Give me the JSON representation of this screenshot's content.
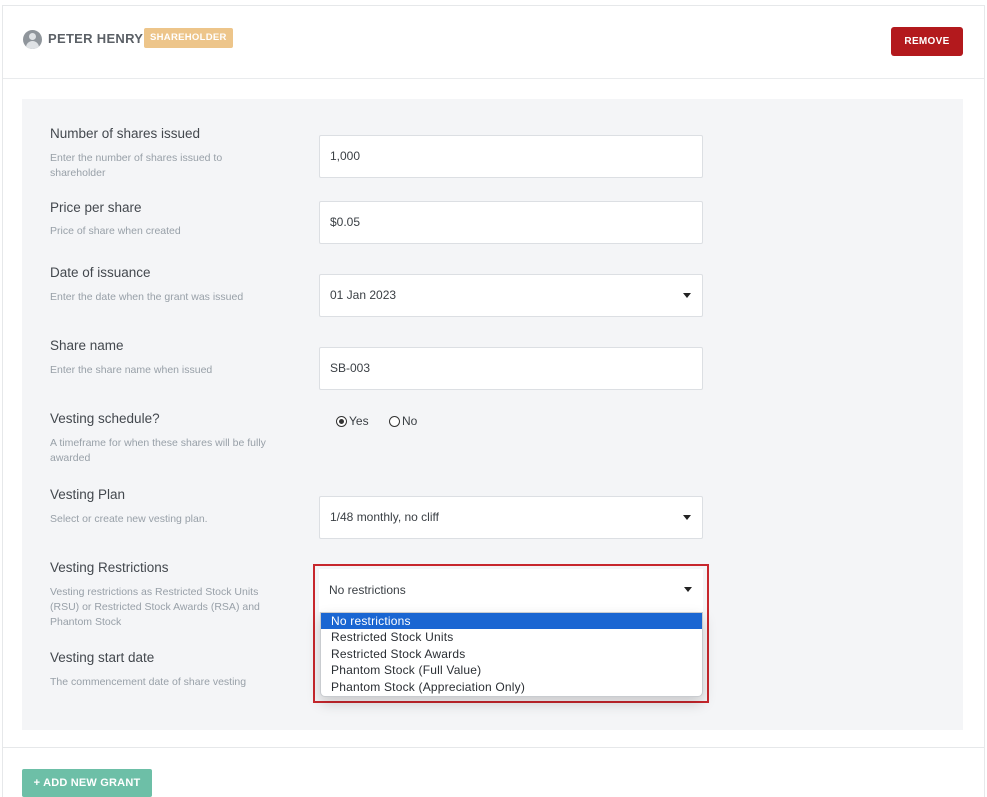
{
  "header": {
    "holder_name": "PETER HENRY",
    "badge": "SHAREHOLDER",
    "remove_label": "REMOVE"
  },
  "form": {
    "shares_issued": {
      "label": "Number of shares issued",
      "hint": "Enter the number of shares issued to shareholder",
      "value": "1,000"
    },
    "price_per_share": {
      "label": "Price per share",
      "hint": "Price of share when created",
      "value": "$0.05"
    },
    "date_of_issuance": {
      "label": "Date of issuance",
      "hint": "Enter the date when the grant was issued",
      "value": "01 Jan 2023"
    },
    "share_name": {
      "label": "Share name",
      "hint": "Enter the share name when issued",
      "value": "SB-003"
    },
    "vesting_schedule": {
      "label": "Vesting schedule?",
      "hint": "A timeframe for when these shares will be fully awarded",
      "yes": "Yes",
      "no": "No",
      "selected": "Yes"
    },
    "vesting_plan": {
      "label": "Vesting Plan",
      "hint": "Select or create new vesting plan.",
      "value": "1/48 monthly, no cliff"
    },
    "vesting_restrictions": {
      "label": "Vesting Restrictions",
      "hint": "Vesting restrictions as Restricted Stock Units (RSU) or Restricted Stock Awards (RSA) and Phantom Stock",
      "value": "No restrictions",
      "options": [
        "No restrictions",
        "Restricted Stock Units",
        "Restricted Stock Awards",
        "Phantom Stock (Full Value)",
        "Phantom Stock (Appreciation Only)"
      ]
    },
    "vesting_start_date": {
      "label": "Vesting start date",
      "hint": "The commencement date of share vesting"
    }
  },
  "footer": {
    "add_grant_label": "+ ADD NEW GRANT"
  },
  "colors": {
    "remove": "#b3191d",
    "badge": "#edc58a",
    "add_grant": "#6dbfa7",
    "highlight": "#c7272d",
    "option_selected": "#1a66d2"
  }
}
